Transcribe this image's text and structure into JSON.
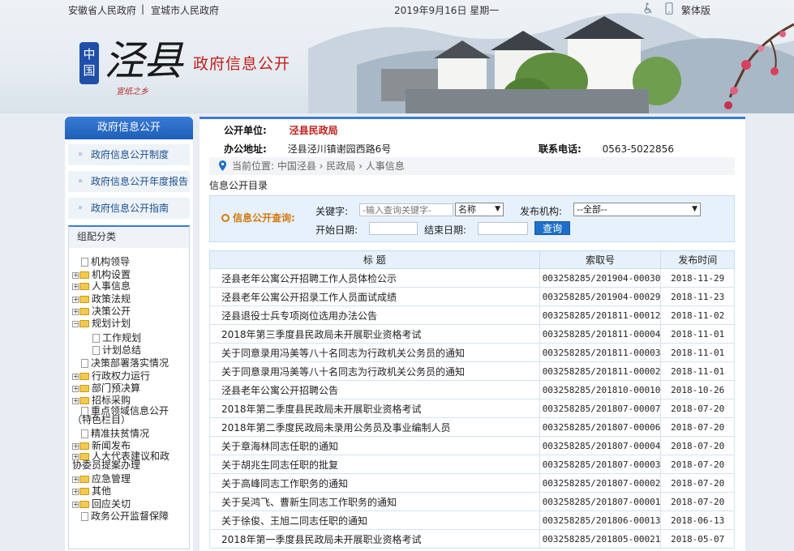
{
  "topbar": {
    "gov_province": "安徽省人民政府",
    "separator": "|",
    "gov_city": "宣城市人民政府",
    "date": "2019年9月16日 星期一",
    "traditional": "繁体版"
  },
  "logo": {
    "badge": "中国",
    "main": "泾县",
    "sub": "宣纸之乡"
  },
  "site_title": "政府信息公开",
  "sidebar": {
    "header": "政府信息公开",
    "links": [
      "政府信息公开制度",
      "政府信息公开年度报告",
      "政府信息公开指南"
    ],
    "group_title": "组配分类",
    "tree": [
      {
        "label": "机构领导",
        "type": "doc",
        "expand": ""
      },
      {
        "label": "机构设置",
        "type": "folder",
        "expand": "+"
      },
      {
        "label": "人事信息",
        "type": "folder",
        "expand": "+"
      },
      {
        "label": "政策法规",
        "type": "folder",
        "expand": "+"
      },
      {
        "label": "决策公开",
        "type": "folder",
        "expand": "+"
      },
      {
        "label": "规划计划",
        "type": "folder",
        "expand": "−"
      },
      {
        "label": "工作规划",
        "type": "doc",
        "expand": "",
        "child": true
      },
      {
        "label": "计划总结",
        "type": "doc",
        "expand": "",
        "child": true
      },
      {
        "label": "决策部署落实情况",
        "type": "doc",
        "expand": ""
      },
      {
        "label": "行政权力运行",
        "type": "folder",
        "expand": "+"
      },
      {
        "label": "部门预决算",
        "type": "folder",
        "expand": "+"
      },
      {
        "label": "招标采购",
        "type": "folder",
        "expand": "+"
      },
      {
        "label": "重点领域信息公开（特色栏目）",
        "type": "doc",
        "expand": "",
        "wrap": true
      },
      {
        "label": "精准扶贫情况",
        "type": "doc",
        "expand": ""
      },
      {
        "label": "新闻发布",
        "type": "folder",
        "expand": "+"
      },
      {
        "label": "人大代表建议和政协委员提案办理",
        "type": "folder",
        "expand": "+",
        "wrap": true
      },
      {
        "label": "应急管理",
        "type": "folder",
        "expand": "+"
      },
      {
        "label": "其他",
        "type": "folder",
        "expand": "+"
      },
      {
        "label": "回应关切",
        "type": "folder",
        "expand": "+"
      },
      {
        "label": "政务公开监督保障",
        "type": "doc",
        "expand": ""
      }
    ]
  },
  "main": {
    "unit_label": "公开单位:",
    "unit_value": "泾县民政局",
    "address_label": "办公地址:",
    "address_value": "泾县泾川镇谢园西路6号",
    "phone_label": "联系电话:",
    "phone_value": "0563-5022856",
    "crumb": "当前位置:  中国泾县 › 民政局 › 人事信息",
    "dir_title": "信息公开目录",
    "query": {
      "label": "信息公开查询:",
      "keyword_label": "关键字:",
      "keyword_placeholder": "-输入查询关键字-",
      "field_select": "名称",
      "org_label": "发布机构:",
      "org_select": "--全部--",
      "start_label": "开始日期:",
      "end_label": "结束日期:",
      "button": "查询"
    },
    "table": {
      "headers": [
        "标 题",
        "索取号",
        "发布时间"
      ],
      "rows": [
        [
          "泾县老年公寓公开招聘工作人员体检公示",
          "003258285/201904-00030",
          "2018-11-29"
        ],
        [
          "泾县老年公寓公开招录工作人员面试成绩",
          "003258285/201904-00029",
          "2018-11-23"
        ],
        [
          "泾县退役士兵专项岗位选用办法公告",
          "003258285/201811-00012",
          "2018-11-02"
        ],
        [
          "2018年第三季度县民政局未开展职业资格考试",
          "003258285/201811-00004",
          "2018-11-01"
        ],
        [
          "关于同意录用冯美等八十名同志为行政机关公务员的通知",
          "003258285/201811-00003",
          "2018-11-01"
        ],
        [
          "关于同意录用冯美等八十名同志为行政机关公务员的通知",
          "003258285/201811-00002",
          "2018-11-01"
        ],
        [
          "泾县老年公寓公开招聘公告",
          "003258285/201810-00010",
          "2018-10-26"
        ],
        [
          "2018年第二季度县民政局未开展职业资格考试",
          "003258285/201807-00007",
          "2018-07-20"
        ],
        [
          "2018年第二季度民政局未录用公务员及事业编制人员",
          "003258285/201807-00006",
          "2018-07-20"
        ],
        [
          "关于章海林同志任职的通知",
          "003258285/201807-00004",
          "2018-07-20"
        ],
        [
          "关于胡兆生同志任职的批复",
          "003258285/201807-00003",
          "2018-07-20"
        ],
        [
          "关于高峰同志工作职务的通知",
          "003258285/201807-00002",
          "2018-07-20"
        ],
        [
          "关于吴鸿飞、曹新生同志工作职务的通知",
          "003258285/201807-00001",
          "2018-07-20"
        ],
        [
          "关于徐俊、王旭二同志任职的通知",
          "003258285/201806-00013",
          "2018-06-13"
        ],
        [
          "2018年第一季度县民政局未开展职业资格考试",
          "003258285/201805-00021",
          "2018-05-07"
        ]
      ]
    }
  },
  "colors": {
    "accent_blue": "#1e5fb8",
    "title_red": "#c0201a",
    "query_orange": "#d27a10"
  }
}
